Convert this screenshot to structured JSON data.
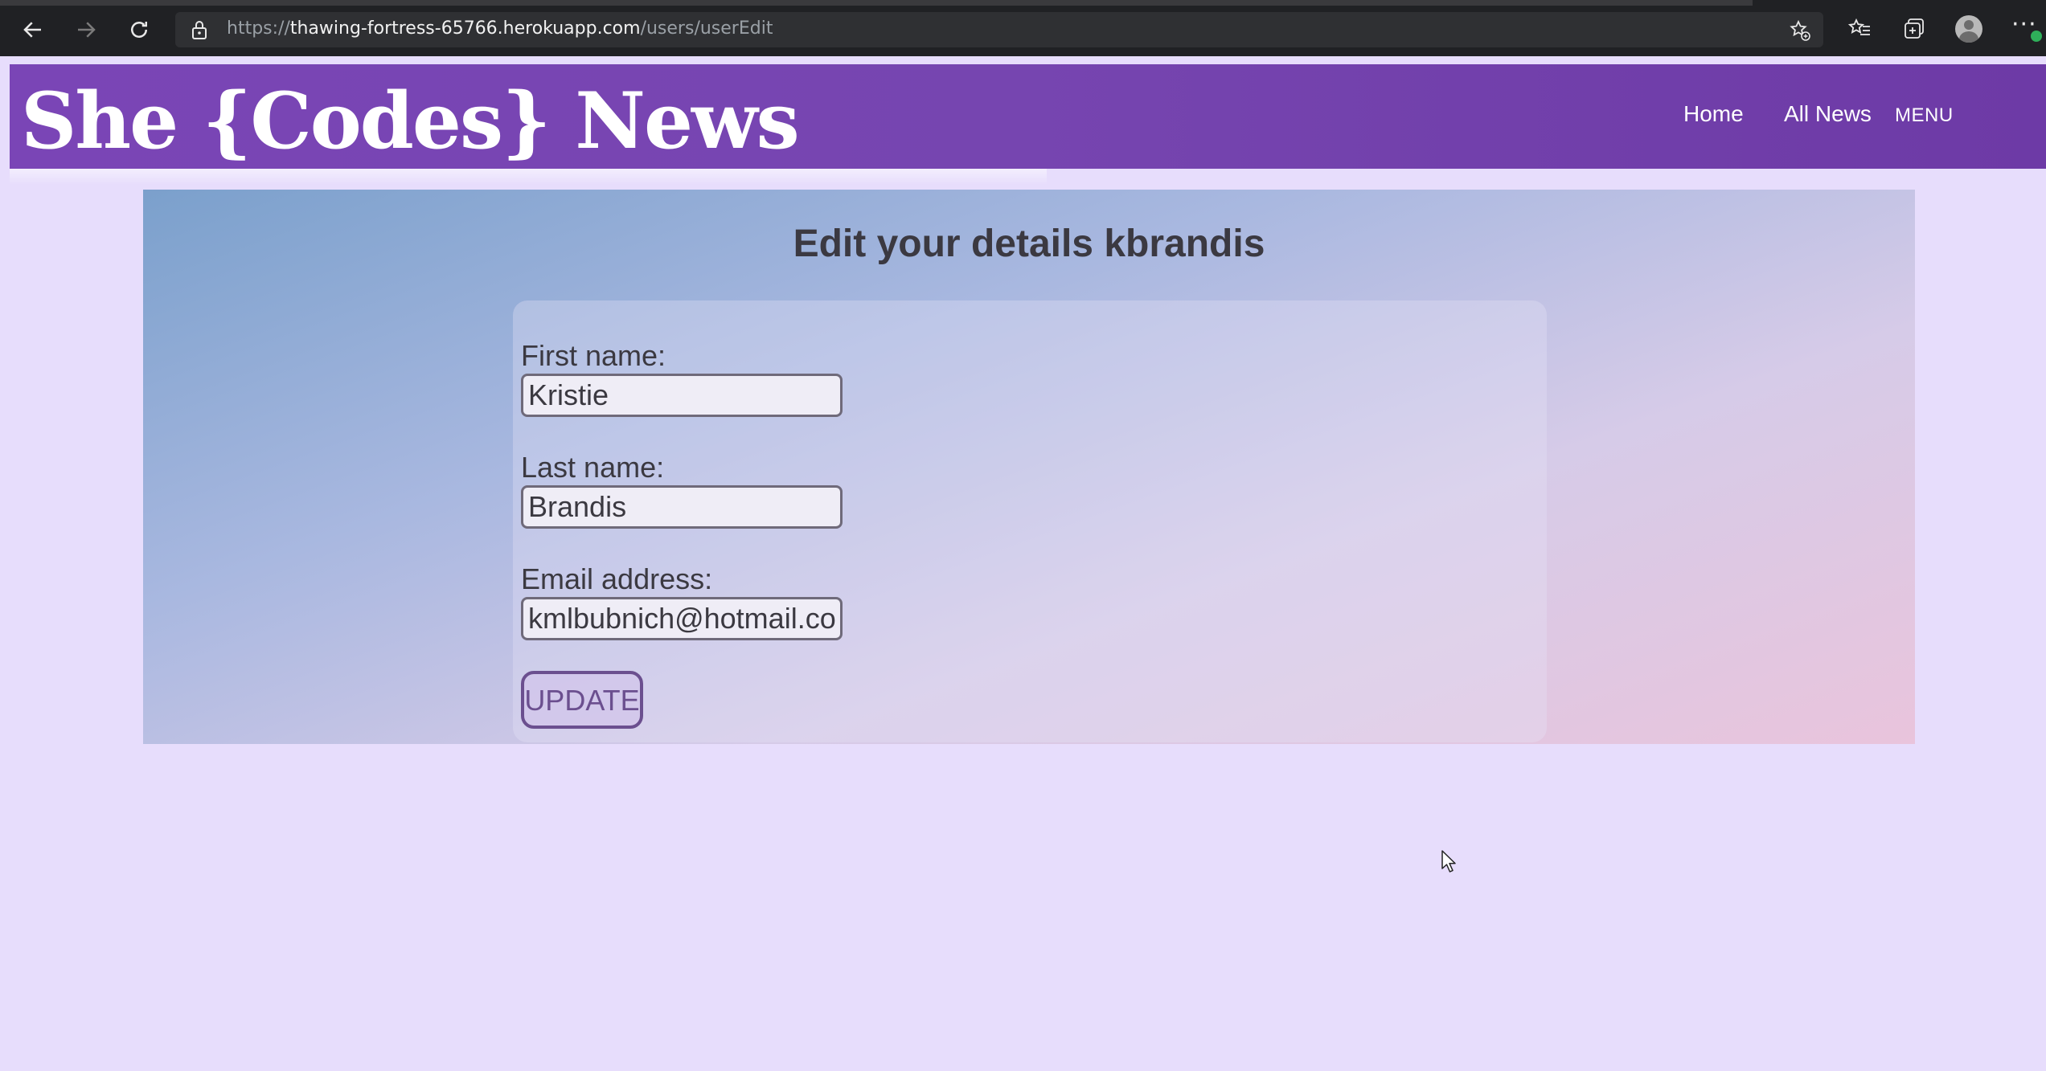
{
  "browser": {
    "url_scheme": "https://",
    "url_host": "thawing-fortress-65766.herokuapp.com",
    "url_path": "/users/userEdit",
    "icons": [
      "back-icon",
      "forward-icon",
      "refresh-icon",
      "lock-icon",
      "add-favorite-icon",
      "favorites-icon",
      "collections-icon",
      "profile-avatar",
      "more-icon"
    ]
  },
  "header": {
    "logo": "She {Codes} News",
    "nav": {
      "home": "Home",
      "all_news": "All News",
      "menu": "MENU"
    }
  },
  "main": {
    "title": "Edit your details kbrandis",
    "form": {
      "first_name_label": "First name:",
      "first_name_value": "Kristie",
      "last_name_label": "Last name:",
      "last_name_value": "Brandis",
      "email_label": "Email address:",
      "email_value": "kmlbubnich@hotmail.com",
      "submit_label": "UPDATE"
    }
  },
  "colors": {
    "page_background": "#e7ddfc",
    "header_purple": "#7a45b6",
    "text_dark": "#3b3941",
    "button_border": "#6b4f8f"
  }
}
